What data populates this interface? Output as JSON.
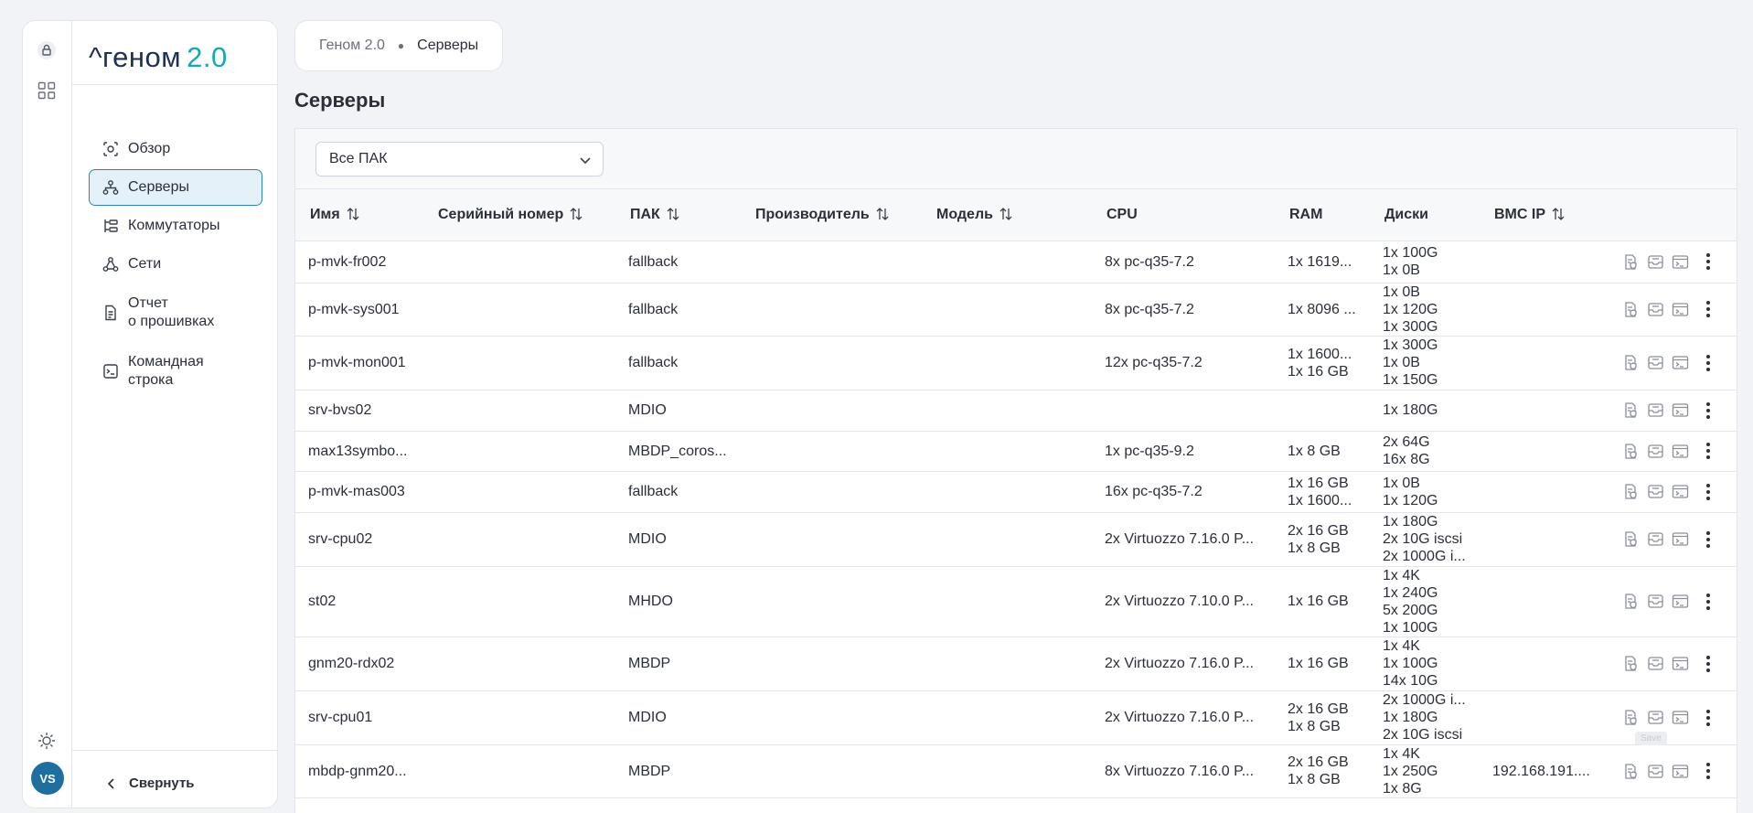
{
  "app": {
    "logo_main": "^геном",
    "logo_version": "2.0",
    "user_initials": "VS"
  },
  "sidebar": {
    "items": [
      {
        "label": "Обзор",
        "icon": "overview-icon"
      },
      {
        "label": "Серверы",
        "icon": "servers-icon",
        "active": true
      },
      {
        "label": "Коммутаторы",
        "icon": "switches-icon"
      },
      {
        "label": "Сети",
        "icon": "networks-icon"
      },
      {
        "label": "Отчет\nо прошивках",
        "icon": "report-icon"
      },
      {
        "label": "Командная\nстрока",
        "icon": "terminal-icon"
      }
    ],
    "collapse_label": "Свернуть"
  },
  "breadcrumb": {
    "root": "Геном 2.0",
    "current": "Серверы"
  },
  "page": {
    "title": "Серверы"
  },
  "filter": {
    "selected": "Все ПАК"
  },
  "table": {
    "columns": [
      "Имя",
      "Серийный номер",
      "ПАК",
      "Производитель",
      "Модель",
      "CPU",
      "RAM",
      "Диски",
      "BMC IP"
    ],
    "sortable": [
      true,
      true,
      true,
      true,
      true,
      false,
      false,
      false,
      true
    ],
    "rows": [
      {
        "name": "p-mvk-fr002",
        "serial": "",
        "pak": "fallback",
        "vendor": "",
        "model": "",
        "cpu": "8x pc-q35-7.2",
        "ram": [
          "1x 1619..."
        ],
        "disks": [
          "1x 100G",
          "1x 0B"
        ],
        "bmc": ""
      },
      {
        "name": "p-mvk-sys001",
        "serial": "",
        "pak": "fallback",
        "vendor": "",
        "model": "",
        "cpu": "8x pc-q35-7.2",
        "ram": [
          "1x 8096 ..."
        ],
        "disks": [
          "1x 0B",
          "1x 120G",
          "1x 300G"
        ],
        "bmc": ""
      },
      {
        "name": "p-mvk-mon001",
        "serial": "",
        "pak": "fallback",
        "vendor": "",
        "model": "",
        "cpu": "12x pc-q35-7.2",
        "ram": [
          "1x 1600...",
          "1x 16 GB"
        ],
        "disks": [
          "1x 300G",
          "1x 0B",
          "1x 150G"
        ],
        "bmc": ""
      },
      {
        "name": "srv-bvs02",
        "serial": "",
        "pak": "MDIO",
        "vendor": "",
        "model": "",
        "cpu": "",
        "ram": [],
        "disks": [
          "1x 180G"
        ],
        "bmc": ""
      },
      {
        "name": "max13symbo...",
        "serial": "",
        "pak": "MBDP_coros...",
        "vendor": "",
        "model": "",
        "cpu": "1x pc-q35-9.2",
        "ram": [
          "1x 8 GB"
        ],
        "disks": [
          "2x 64G",
          "16x 8G"
        ],
        "bmc": ""
      },
      {
        "name": "p-mvk-mas003",
        "serial": "",
        "pak": "fallback",
        "vendor": "",
        "model": "",
        "cpu": "16x pc-q35-7.2",
        "ram": [
          "1x 16 GB",
          "1x 1600..."
        ],
        "disks": [
          "1x 0B",
          "1x 120G"
        ],
        "bmc": ""
      },
      {
        "name": "srv-cpu02",
        "serial": "",
        "pak": "MDIO",
        "vendor": "",
        "model": "",
        "cpu": "2x Virtuozzo 7.16.0 P...",
        "ram": [
          "2x 16 GB",
          "1x 8 GB"
        ],
        "disks": [
          "1x 180G",
          "2x 10G iscsi",
          "2x 1000G i..."
        ],
        "bmc": ""
      },
      {
        "name": "st02",
        "serial": "",
        "pak": "MHDO",
        "vendor": "",
        "model": "",
        "cpu": "2x Virtuozzo 7.10.0 P...",
        "ram": [
          "1x 16 GB"
        ],
        "disks": [
          "1x 4K",
          "1x 240G",
          "5x 200G",
          "1x 100G"
        ],
        "bmc": ""
      },
      {
        "name": "gnm20-rdx02",
        "serial": "",
        "pak": "MBDP",
        "vendor": "",
        "model": "",
        "cpu": "2x Virtuozzo 7.16.0 P...",
        "ram": [
          "1x 16 GB"
        ],
        "disks": [
          "1x 4K",
          "1x 100G",
          "14x 10G"
        ],
        "bmc": ""
      },
      {
        "name": "srv-cpu01",
        "serial": "",
        "pak": "MDIO",
        "vendor": "",
        "model": "",
        "cpu": "2x Virtuozzo 7.16.0 P...",
        "ram": [
          "2x 16 GB",
          "1x 8 GB"
        ],
        "disks": [
          "2x 1000G i...",
          "1x 180G",
          "2x 10G iscsi"
        ],
        "bmc": ""
      },
      {
        "name": "mbdp-gnm20...",
        "serial": "",
        "pak": "MBDP",
        "vendor": "",
        "model": "",
        "cpu": "8x Virtuozzo 7.16.0 P...",
        "ram": [
          "2x 16 GB",
          "1x 8 GB"
        ],
        "disks": [
          "1x 4K",
          "1x 250G",
          "1x 8G"
        ],
        "bmc": "192.168.191...."
      }
    ]
  },
  "tooltip": "Save"
}
